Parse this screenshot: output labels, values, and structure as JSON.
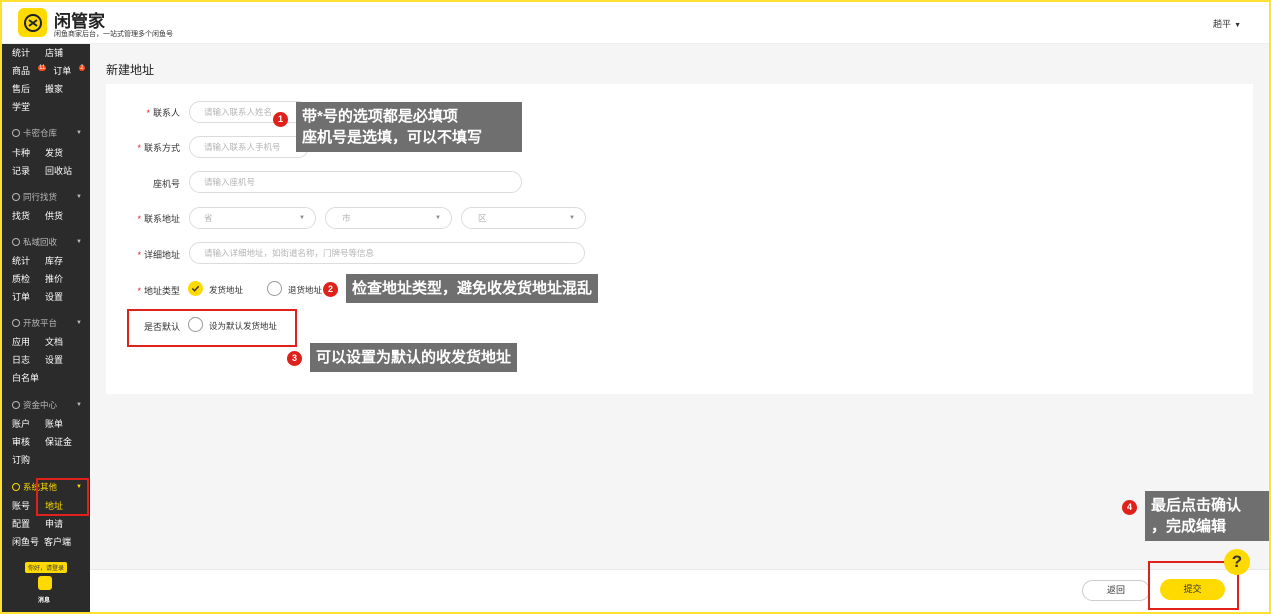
{
  "header": {
    "app_name": "闲管家",
    "tagline": "闲鱼商家后台，一站式管理多个闲鱼号",
    "user": "趟平",
    "user_caret": "▼"
  },
  "sidebar": {
    "group1": [
      "统计",
      "店铺"
    ],
    "group1b": [
      "商品",
      "订单"
    ],
    "badges": [
      "11",
      "2"
    ],
    "group1c": [
      "售后",
      "搬家"
    ],
    "group1d": "学堂",
    "section_card": "卡密仓库",
    "card_row1": [
      "卡种",
      "发货"
    ],
    "card_row2": [
      "记录",
      "回收站"
    ],
    "section_peer": "同行找货",
    "peer_row1": [
      "找货",
      "供货"
    ],
    "section_recycle": "私域回收",
    "recycle_row1": [
      "统计",
      "库存"
    ],
    "recycle_row2": [
      "质检",
      "推价"
    ],
    "recycle_row3": [
      "订单",
      "设置"
    ],
    "section_open": "开放平台",
    "open_row1": [
      "应用",
      "文档"
    ],
    "open_row2": [
      "日志",
      "设置"
    ],
    "open_row3": "白名单",
    "section_fund": "资金中心",
    "fund_row1": [
      "账户",
      "账单"
    ],
    "fund_row2": [
      "审核",
      "保证金"
    ],
    "fund_row3": "订购",
    "section_sys": "系统其他",
    "sys_row1": [
      "账号",
      "地址"
    ],
    "sys_row2": [
      "配置",
      "申请"
    ],
    "sys_row3": [
      "闲鱼号",
      "客户端"
    ],
    "login_tag": "你好，请登录",
    "msg_label": "消息"
  },
  "page": {
    "title": "新建地址"
  },
  "form": {
    "contact_label": "联系人",
    "contact_placeholder": "请输入联系人姓名",
    "phone_label": "联系方式",
    "phone_placeholder": "请输入联系人手机号",
    "landline_label": "座机号",
    "landline_placeholder": "请输入座机号",
    "address_label": "联系地址",
    "province": "省",
    "city": "市",
    "district": "区",
    "detail_label": "详细地址",
    "detail_placeholder": "请输入详细地址，如街道名称，门牌号等信息",
    "type_label": "地址类型",
    "type_ship": "发货地址",
    "type_return": "退货地址",
    "default_label": "是否默认",
    "default_option": "设为默认发货地址",
    "required_mark": "*"
  },
  "callouts": {
    "c1_num": "1",
    "c1_line1": "带*号的选项都是必填项",
    "c1_line2": "座机号是选填，可以不填写",
    "c2_num": "2",
    "c2_text": "检查地址类型，避免收发货地址混乱",
    "c3_num": "3",
    "c3_text": "可以设置为默认的收发货地址",
    "c4_num": "4",
    "c4_line1": "最后点击确认",
    "c4_line2": "，完成编辑"
  },
  "footer": {
    "back": "返回",
    "submit": "提交",
    "help": "?"
  },
  "colors": {
    "brand_yellow": "#ffda00",
    "sidebar_bg": "#2b2b2b",
    "annotation_red": "#e0201a",
    "callout_gray": "#6f6f6f"
  }
}
